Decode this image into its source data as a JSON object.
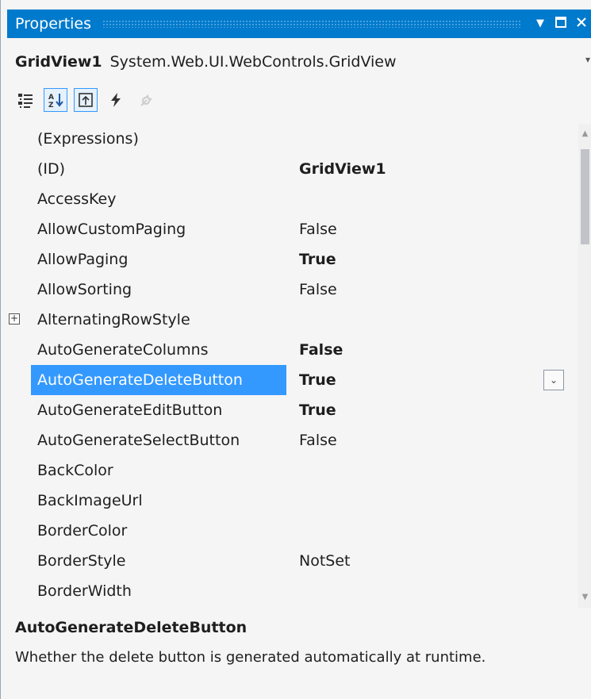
{
  "window": {
    "title": "Properties",
    "pin_icon": "pin-dropdown-icon",
    "maximize_icon": "maximize-icon",
    "close_icon": "close-icon"
  },
  "object_selector": {
    "name": "GridView1",
    "type": "System.Web.UI.WebControls.GridView"
  },
  "toolbar": {
    "buttons": [
      {
        "icon": "categorized-icon",
        "active": false,
        "enabled": true
      },
      {
        "icon": "alphabetical-icon",
        "active": true,
        "enabled": true
      },
      {
        "icon": "properties-icon",
        "active": true,
        "enabled": true
      },
      {
        "icon": "events-lightning-icon",
        "active": false,
        "enabled": true
      },
      {
        "icon": "property-pages-wrench-icon",
        "active": false,
        "enabled": false
      }
    ]
  },
  "properties": [
    {
      "name": "(Expressions)",
      "value": "",
      "bold": false,
      "expandable": false
    },
    {
      "name": "(ID)",
      "value": "GridView1",
      "bold": true,
      "expandable": false
    },
    {
      "name": "AccessKey",
      "value": "",
      "bold": false,
      "expandable": false
    },
    {
      "name": "AllowCustomPaging",
      "value": "False",
      "bold": false,
      "expandable": false
    },
    {
      "name": "AllowPaging",
      "value": "True",
      "bold": true,
      "expandable": false
    },
    {
      "name": "AllowSorting",
      "value": "False",
      "bold": false,
      "expandable": false
    },
    {
      "name": "AlternatingRowStyle",
      "value": "",
      "bold": false,
      "expandable": true
    },
    {
      "name": "AutoGenerateColumns",
      "value": "False",
      "bold": true,
      "expandable": false
    },
    {
      "name": "AutoGenerateDeleteButton",
      "value": "True",
      "bold": true,
      "expandable": false,
      "selected": true
    },
    {
      "name": "AutoGenerateEditButton",
      "value": "True",
      "bold": true,
      "expandable": false
    },
    {
      "name": "AutoGenerateSelectButton",
      "value": "False",
      "bold": false,
      "expandable": false
    },
    {
      "name": "BackColor",
      "value": "",
      "bold": false,
      "expandable": false
    },
    {
      "name": "BackImageUrl",
      "value": "",
      "bold": false,
      "expandable": false
    },
    {
      "name": "BorderColor",
      "value": "",
      "bold": false,
      "expandable": false
    },
    {
      "name": "BorderStyle",
      "value": "NotSet",
      "bold": false,
      "expandable": false
    },
    {
      "name": "BorderWidth",
      "value": "",
      "bold": false,
      "expandable": false
    }
  ],
  "description": {
    "title": "AutoGenerateDeleteButton",
    "text": "Whether the delete button is generated automatically at runtime."
  },
  "colors": {
    "titlebar": "#007acc",
    "selection": "#3399ff",
    "background": "#f5f5f5"
  }
}
